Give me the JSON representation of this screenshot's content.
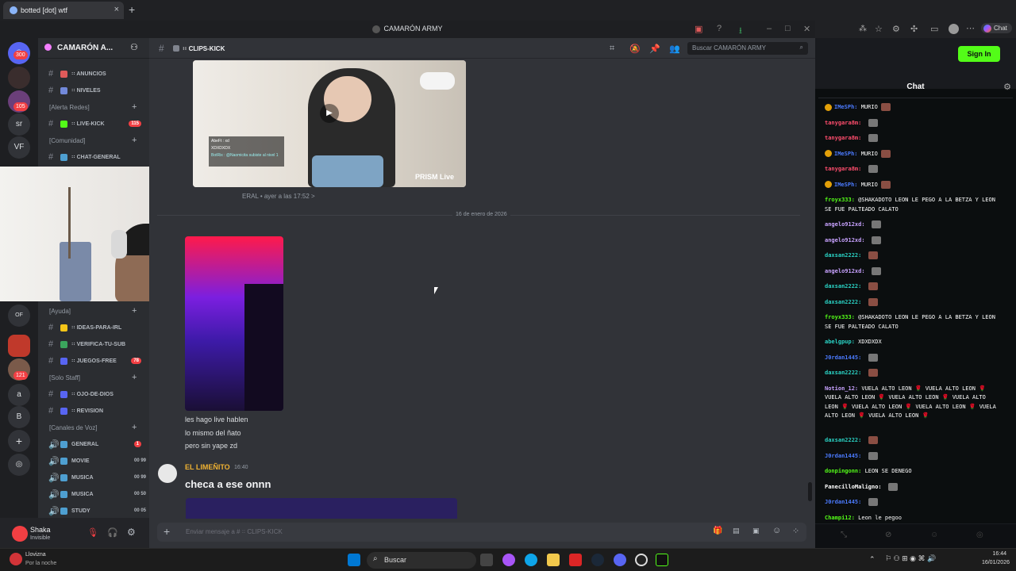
{
  "browser": {
    "tab_title": "botted [dot] wtf",
    "new_tab": "+",
    "close": "×"
  },
  "discord": {
    "window_title": "CAMARÓN ARMY",
    "server_name": "CAMARÓN A...",
    "rail": {
      "badge_top": "300",
      "badge_2": "105",
      "label_sr": "sr",
      "label_vf": "VF",
      "label_of": "OF",
      "badge_3": "121",
      "label_a": "a",
      "label_b": "B"
    },
    "channels": [
      {
        "name": "ANUNCIOS",
        "mark": "꞉꞉ ",
        "emoji_color": "#e05a5a"
      },
      {
        "name": "NIVELES",
        "mark": "꞉꞉ ",
        "emoji_color": "#7289da"
      },
      {
        "category": "[Alerta Redes]"
      },
      {
        "name": "LIVE-KICK",
        "mark": "꞉꞉ ",
        "emoji_color": "#53fc18",
        "count": "115"
      },
      {
        "category": "[Comunidad]"
      },
      {
        "name": "CHAT-GENERAL",
        "mark": "꞉꞉ "
      }
    ],
    "channels_lower": [
      {
        "category": "[Ayuda]"
      },
      {
        "name": "IDEAS-PARA-IRL",
        "mark": "꞉꞉ ",
        "emoji_color": "#f5c518"
      },
      {
        "name": "VERIFICA-TU-SUB",
        "mark": "꞉꞉ ",
        "emoji_color": "#3ba55d"
      },
      {
        "name": "JUEGOS-FREE",
        "mark": "꞉꞉ ",
        "emoji_color": "#5865f2",
        "count": "78"
      },
      {
        "category": "[Solo Staff]"
      },
      {
        "name": "OJO-DE-DIOS",
        "mark": "꞉꞉ ",
        "emoji_color": "#5865f2"
      },
      {
        "name": "REVISION",
        "mark": "꞉꞉ ",
        "emoji_color": "#5865f2"
      },
      {
        "category": "[Canales de Voz]"
      },
      {
        "name": "GENERAL",
        "voice": "",
        "badge": "1"
      },
      {
        "name": "MOVIE",
        "voice": "00  99"
      },
      {
        "name": "MUSICA",
        "voice": "00  99"
      },
      {
        "name": "MUSICA",
        "voice": "00  50"
      },
      {
        "name": "STUDY",
        "voice": "00  05"
      }
    ],
    "user": {
      "name": "Shaka",
      "status": "Invisible"
    },
    "channel_header": {
      "name": "CLIPS-KICK",
      "mark": "꞉꞉ ",
      "search_placeholder": "Buscar CAMARÓN ARMY"
    },
    "messages": {
      "video_watermark": "PRISM Live",
      "video_overlay_1": "AbeFt : xd",
      "video_overlay_2": "XDXDXDX",
      "video_overlay_3": "BotRix : @Naomicita subiste al nivel 1",
      "meta_1": "ERAL  •  ayer a las 17:52  >",
      "date_divider": "16 de enero de 2026",
      "lines": [
        "les hago live hablen",
        "lo mismo del ñato",
        "pero sin yape zd"
      ],
      "author": "EL LIMEÑITO",
      "time": "16:40",
      "big_text": "checa a ese onnn"
    },
    "composer_placeholder": "Enviar mensaje a #  ꞉꞉ CLIPS-KICK"
  },
  "kick": {
    "sign_in": "Sign In",
    "chat_title": "Chat",
    "messages": [
      {
        "user": "IMeSPh:",
        "color": "#4b7bff",
        "text": "MURIO",
        "pin": true,
        "emote": true
      },
      {
        "user": "tanygara8m:",
        "color": "#ff4d6d",
        "text": "",
        "emote_gray": true
      },
      {
        "user": "tanygara8m:",
        "color": "#ff4d6d",
        "text": "",
        "emote_gray": true
      },
      {
        "user": "IMeSPh:",
        "color": "#4b7bff",
        "text": "MURIO",
        "pin": true,
        "emote": true
      },
      {
        "user": "tanygara8m:",
        "color": "#ff4d6d",
        "text": "",
        "emote_gray": true
      },
      {
        "user": "IMeSPh:",
        "color": "#4b7bff",
        "text": "MURIO",
        "pin": true,
        "emote": true
      },
      {
        "user": "froyx333:",
        "color": "#53fc18",
        "text": "@SHAKADOTO LEON LE PEGO A LA BETZA Y LEON SE FUE PALTEADO CALATO"
      },
      {
        "user": "angelo912xd:",
        "color": "#c8a2ff",
        "text": "",
        "emote_gray": true
      },
      {
        "user": "angelo912xd:",
        "color": "#c8a2ff",
        "text": "",
        "emote_gray": true
      },
      {
        "user": "daxsan2222:",
        "color": "#2ad4c6",
        "text": "",
        "emote": true
      },
      {
        "user": "angelo912xd:",
        "color": "#c8a2ff",
        "text": "",
        "emote_gray": true
      },
      {
        "user": "daxsan2222:",
        "color": "#2ad4c6",
        "text": "",
        "emote": true
      },
      {
        "user": "daxsan2222:",
        "color": "#2ad4c6",
        "text": "",
        "emote": true
      },
      {
        "user": "froyx333:",
        "color": "#53fc18",
        "text": "@SHAKADOTO LEON LE PEGO A LA BETZA Y LEON SE FUE PALTEADO CALATO"
      },
      {
        "user": "abelgpup:",
        "color": "#2ad4c6",
        "text": "XDXDXDX"
      },
      {
        "user": "J0rdan1445:",
        "color": "#4b7bff",
        "text": "",
        "emote_gray": true
      },
      {
        "user": "daxsan2222:",
        "color": "#2ad4c6",
        "text": "",
        "emote": true
      },
      {
        "user": "Notion_12:",
        "color": "#c8a2ff",
        "text": "VUELA ALTO LEON 🌹  VUELA ALTO LEON 🌹 VUELA ALTO LEON 🌹  VUELA ALTO LEON 🌹  VUELA ALTO LEON 🌹  VUELA ALTO LEON 🌹  VUELA ALTO LEON 🌹 VUELA ALTO LEON 🌹  VUELA ALTO LEON 🌹"
      },
      {
        "user": "daxsan2222:",
        "color": "#2ad4c6",
        "text": "",
        "emote": true
      },
      {
        "user": "J0rdan1445:",
        "color": "#4b7bff",
        "text": "",
        "emote_gray": true
      },
      {
        "user": "donpingonn:",
        "color": "#53fc18",
        "text": "LEON SE DENEGO"
      },
      {
        "user": "PanecilloMaligno:",
        "color": "#ffffff",
        "text": "",
        "emote_gray": true
      },
      {
        "user": "J0rdan1445:",
        "color": "#4b7bff",
        "text": "",
        "emote_gray": true
      },
      {
        "user": "Champi12:",
        "color": "#53fc18",
        "text": "Leon le pegoo"
      }
    ]
  },
  "taskbar": {
    "weather_temp": "Llovizna",
    "weather_sub": "Por la noche",
    "search": "Buscar",
    "time": "16:44",
    "date": "16/01/2026"
  }
}
